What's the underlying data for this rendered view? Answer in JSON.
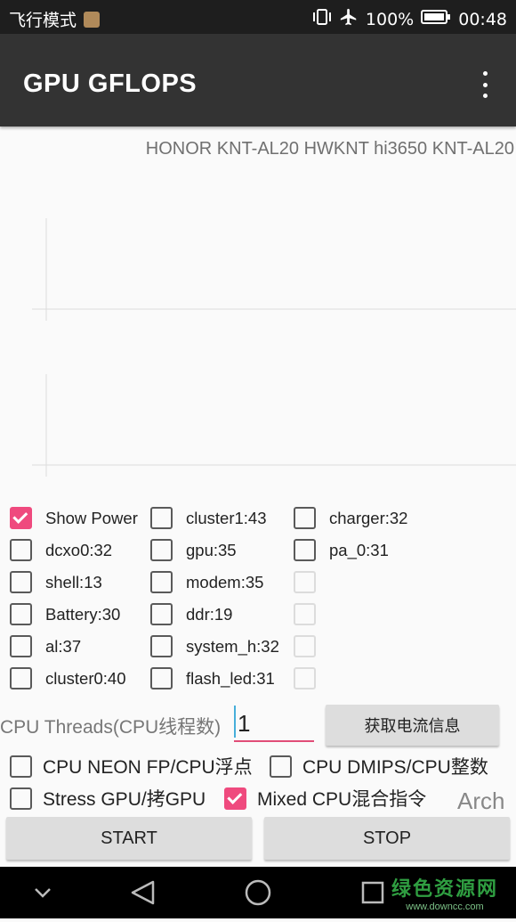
{
  "status_bar": {
    "left_text": "飞行模式",
    "battery": "100%",
    "time": "00:48",
    "icons": [
      "app-notification-icon",
      "vibrate-icon",
      "airplane-icon",
      "battery-icon"
    ]
  },
  "app_bar": {
    "title": "GPU GFLOPS",
    "menu_icon": "overflow-menu-icon"
  },
  "device_info": "HONOR KNT-AL20 HWKNT hi3650 KNT-AL20",
  "checkboxes": {
    "col1": [
      {
        "label": "Show Power",
        "checked": true
      },
      {
        "label": "dcxo0:32",
        "checked": false
      },
      {
        "label": "shell:13",
        "checked": false
      },
      {
        "label": "Battery:30",
        "checked": false
      },
      {
        "label": "al:37",
        "checked": false
      },
      {
        "label": "cluster0:40",
        "checked": false
      }
    ],
    "col2": [
      {
        "label": "cluster1:43",
        "checked": false
      },
      {
        "label": "gpu:35",
        "checked": false
      },
      {
        "label": "modem:35",
        "checked": false
      },
      {
        "label": "ddr:19",
        "checked": false
      },
      {
        "label": "system_h:32",
        "checked": false
      },
      {
        "label": "flash_led:31",
        "checked": false
      }
    ],
    "col3": [
      {
        "label": "charger:32",
        "checked": false
      },
      {
        "label": "pa_0:31",
        "checked": false
      },
      {
        "label": "",
        "checked": false
      },
      {
        "label": "",
        "checked": false
      },
      {
        "label": "",
        "checked": false
      },
      {
        "label": "",
        "checked": false
      }
    ]
  },
  "threads": {
    "label": "CPU Threads(CPU线程数)",
    "value": "1",
    "fetch_button": "获取电流信息"
  },
  "options": {
    "neon": {
      "label": "CPU NEON FP/CPU浮点",
      "checked": false
    },
    "dmips": {
      "label": "CPU DMIPS/CPU整数",
      "checked": false
    },
    "stress_gpu": {
      "label": "Stress GPU/拷GPU",
      "checked": false
    },
    "mixed": {
      "label": "Mixed CPU混合指令",
      "checked": true
    }
  },
  "arch_label": "Arch",
  "buttons": {
    "start": "START",
    "stop": "STOP"
  },
  "nav_bar": {
    "icons": [
      "chevron-down-icon",
      "back-triangle-icon",
      "home-circle-icon",
      "recents-square-icon"
    ]
  },
  "watermark": {
    "line1": "绿色资源网",
    "line2": "www.downcc.com"
  },
  "colors": {
    "accent": "#ef4a7e",
    "app_bar": "#333333",
    "status_bar": "#1e1e1e",
    "button": "#dddddd"
  }
}
